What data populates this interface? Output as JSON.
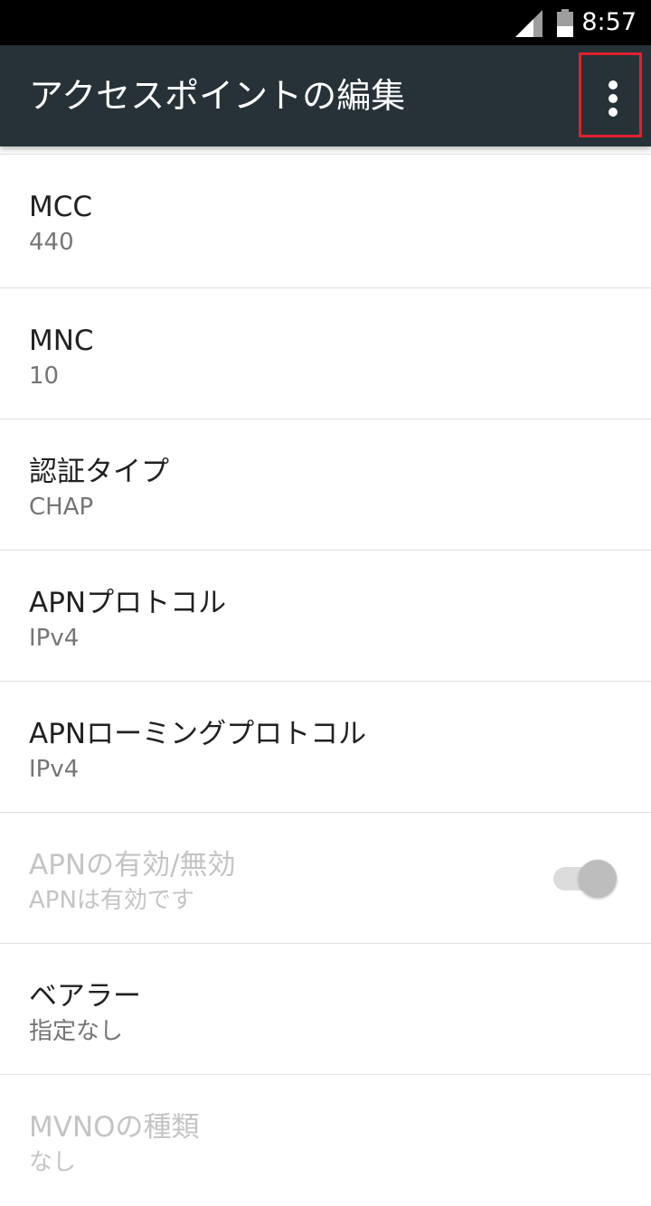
{
  "status_bar": {
    "time": "8:57",
    "icons": [
      "signal-icon",
      "battery-icon"
    ]
  },
  "app_bar": {
    "title": "アクセスポイントの編集",
    "menu_icon": "more-vert-icon",
    "highlight_color": "#e0212e",
    "background_color": "#263238"
  },
  "settings": [
    {
      "title": "MCC",
      "summary": "440",
      "enabled": true
    },
    {
      "title": "MNC",
      "summary": "10",
      "enabled": true
    },
    {
      "title": "認証タイプ",
      "summary": "CHAP",
      "enabled": true
    },
    {
      "title": "APNプロトコル",
      "summary": "IPv4",
      "enabled": true
    },
    {
      "title": "APNローミングプロトコル",
      "summary": "IPv4",
      "enabled": true
    },
    {
      "title": "APNの有効/無効",
      "summary": "APNは有効です",
      "enabled": false,
      "toggle": true,
      "toggle_on": true
    },
    {
      "title": "ベアラー",
      "summary": "指定なし",
      "enabled": true
    },
    {
      "title": "MVNOの種類",
      "summary": "なし",
      "enabled": false
    }
  ]
}
